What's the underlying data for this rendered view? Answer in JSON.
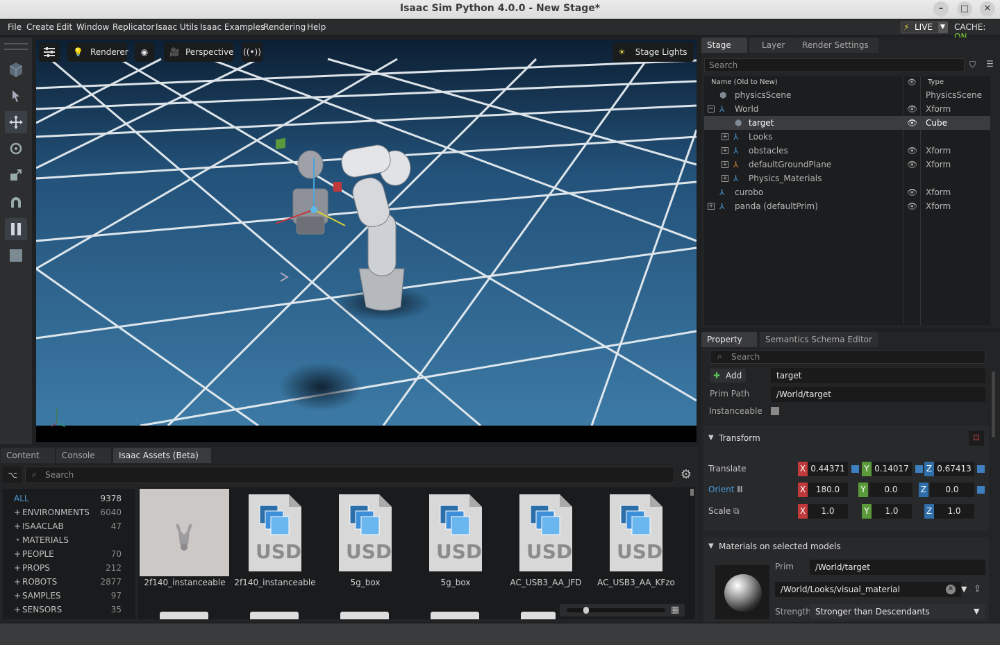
{
  "window": {
    "title": "Isaac Sim Python 4.0.0 - New Stage*"
  },
  "menu": [
    "File",
    "Create",
    "Edit",
    "Window",
    "Replicator",
    "Isaac Utils",
    "Isaac Examples",
    "Rendering",
    "Help"
  ],
  "status": {
    "live": "LIVE",
    "cache_label": "CACHE:",
    "cache_value": "ON"
  },
  "viewport": {
    "renderer": "Renderer",
    "camera": "Perspective",
    "lights": "Stage Lights"
  },
  "stage": {
    "tabs": [
      "Stage",
      "Layer",
      "Render Settings"
    ],
    "search_placeholder": "Search",
    "col_name": "Name (Old to New)",
    "col_type": "Type",
    "rows": [
      {
        "name": "physicsScene",
        "type": "PhysicsScene"
      },
      {
        "name": "World",
        "type": "Xform"
      },
      {
        "name": "target",
        "type": "Cube"
      },
      {
        "name": "Looks",
        "type": ""
      },
      {
        "name": "obstacles",
        "type": "Xform"
      },
      {
        "name": "defaultGroundPlane",
        "type": "Xform"
      },
      {
        "name": "Physics_Materials",
        "type": ""
      },
      {
        "name": "curobo",
        "type": "Xform"
      },
      {
        "name": "panda (defaultPrim)",
        "type": "Xform"
      }
    ]
  },
  "property": {
    "tabs": [
      "Property",
      "Semantics Schema Editor"
    ],
    "search_placeholder": "Search",
    "add_label": "Add",
    "prim_name": "target",
    "prim_path_label": "Prim Path",
    "prim_path": "/World/target",
    "instanceable_label": "Instanceable",
    "transform_label": "Transform",
    "translate_label": "Translate",
    "translate": [
      "0.44371",
      "0.14017",
      "0.67413"
    ],
    "orient_label": "Orient",
    "orient": [
      "180.0",
      "0.0",
      "0.0"
    ],
    "scale_label": "Scale",
    "scale": [
      "1.0",
      "1.0",
      "1.0"
    ],
    "axes": [
      "X",
      "Y",
      "Z"
    ],
    "materials_label": "Materials on selected models",
    "prim_label": "Prim",
    "mat_prim": "/World/target",
    "material": "/World/Looks/visual_material",
    "strength_label": "Strength",
    "strength": "Stronger than Descendants"
  },
  "bottom": {
    "tabs": [
      "Content",
      "Console",
      "Isaac Assets (Beta)"
    ],
    "search_placeholder": "Search",
    "categories": [
      {
        "prefix": "",
        "name": "ALL",
        "count": "9378"
      },
      {
        "prefix": "+",
        "name": "ENVIRONMENTS",
        "count": "6040"
      },
      {
        "prefix": "+",
        "name": "ISAACLAB",
        "count": "47"
      },
      {
        "prefix": "•",
        "name": "MATERIALS",
        "count": ""
      },
      {
        "prefix": "+",
        "name": "PEOPLE",
        "count": "70"
      },
      {
        "prefix": "+",
        "name": "PROPS",
        "count": "212"
      },
      {
        "prefix": "+",
        "name": "ROBOTS",
        "count": "2877"
      },
      {
        "prefix": "+",
        "name": "SAMPLES",
        "count": "97"
      },
      {
        "prefix": "+",
        "name": "SENSORS",
        "count": "35"
      }
    ],
    "assets": [
      "2f140_instanceable",
      "2f140_instanceable",
      "5g_box",
      "5g_box",
      "AC_USB3_AA_JFD",
      "AC_USB3_AA_KFzo"
    ],
    "usd_text": "USD"
  },
  "colors": {
    "x": "#c0393b",
    "y": "#5a9a3a",
    "z": "#2f6ea8",
    "accent": "#3d8fd9",
    "live": "#e5c442",
    "cache_on": "#7fcf3a"
  }
}
